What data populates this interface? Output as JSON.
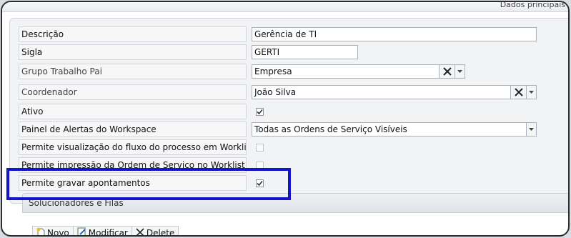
{
  "header": {
    "title": "Dados principais"
  },
  "form": {
    "rows": [
      {
        "label": "Descrição",
        "value": "Gerência de TI"
      },
      {
        "label": "Sigla",
        "value": "GERTI"
      },
      {
        "label": "Grupo Trabalho Pai",
        "value": "Empresa"
      },
      {
        "label": "Coordenador",
        "value": "João Silva"
      },
      {
        "label": "Ativo",
        "checked": true
      },
      {
        "label": "Painel de Alertas do Workspace",
        "value": "Todas as Ordens de Serviço Visíveis"
      },
      {
        "label": "Permite visualização do fluxo do processo em Worklist",
        "checked": false
      },
      {
        "label": "Permite impressão da Ordem de Serviço no Worklist",
        "checked": false
      },
      {
        "label": "Permite gravar apontamentos",
        "checked": true
      }
    ]
  },
  "section": {
    "title": "Solucionadores e Filas"
  },
  "toolbar": {
    "new_label": "Novo",
    "edit_label": "Modificar",
    "delete_label": "Delete"
  },
  "colors": {
    "highlight": "#1414c8"
  }
}
